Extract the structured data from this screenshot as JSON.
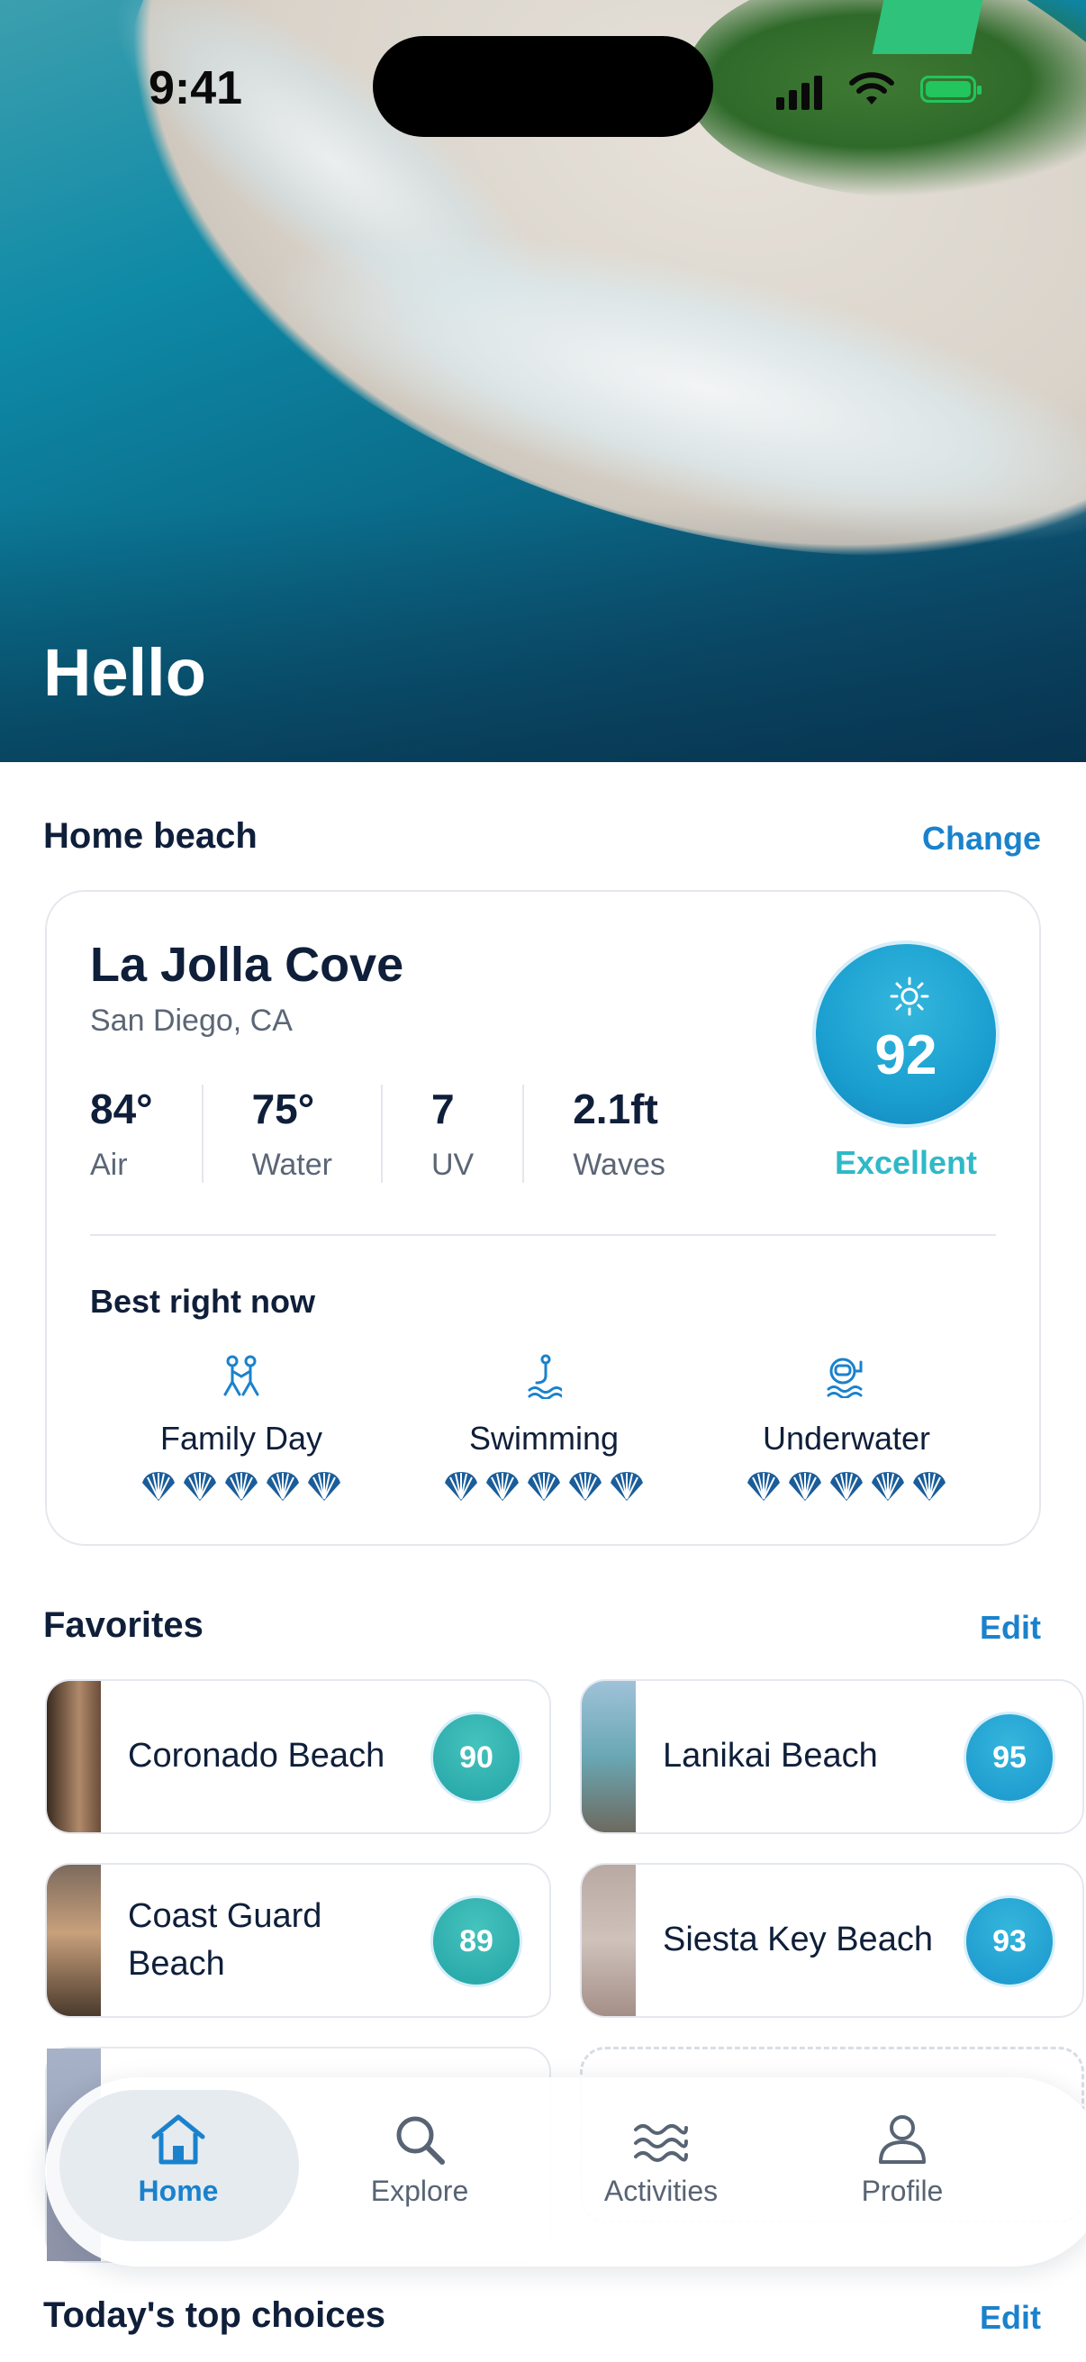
{
  "status_bar": {
    "time": "9:41"
  },
  "hero": {
    "greeting": "Hello"
  },
  "home_beach": {
    "section_title": "Home beach",
    "change_label": "Change",
    "name": "La Jolla Cove",
    "location": "San Diego, CA",
    "metrics": [
      {
        "value": "84°",
        "label": "Air"
      },
      {
        "value": "75°",
        "label": "Water"
      },
      {
        "value": "7",
        "label": "UV"
      },
      {
        "value": "2.1ft",
        "label": "Waves"
      }
    ],
    "score": "92",
    "score_label": "Excellent",
    "best_title": "Best right now",
    "activities": [
      {
        "name": "Family Day",
        "icon": "family-icon",
        "rating": 5
      },
      {
        "name": "Swimming",
        "icon": "swimmer-icon",
        "rating": 5
      },
      {
        "name": "Underwater",
        "icon": "diver-icon",
        "rating": 5
      }
    ]
  },
  "favorites": {
    "section_title": "Favorites",
    "edit_label": "Edit",
    "items": [
      {
        "name": "Coronado Beach",
        "score": "90"
      },
      {
        "name": "Lanikai Beach",
        "score": "95"
      },
      {
        "name": "Coast Guard Beach",
        "score": "89"
      },
      {
        "name": "Siesta Key Beach",
        "score": "93"
      }
    ]
  },
  "top_choices": {
    "section_title": "Today's top choices",
    "edit_label": "Edit"
  },
  "tab_bar": {
    "tabs": [
      {
        "label": "Home",
        "icon": "home-icon",
        "active": true
      },
      {
        "label": "Explore",
        "icon": "search-icon",
        "active": false
      },
      {
        "label": "Activities",
        "icon": "waves-icon",
        "active": false
      },
      {
        "label": "Profile",
        "icon": "person-icon",
        "active": false
      }
    ]
  },
  "colors": {
    "accent": "#1a82cc",
    "teal": "#2fb9c7",
    "text": "#0f1f3a"
  }
}
